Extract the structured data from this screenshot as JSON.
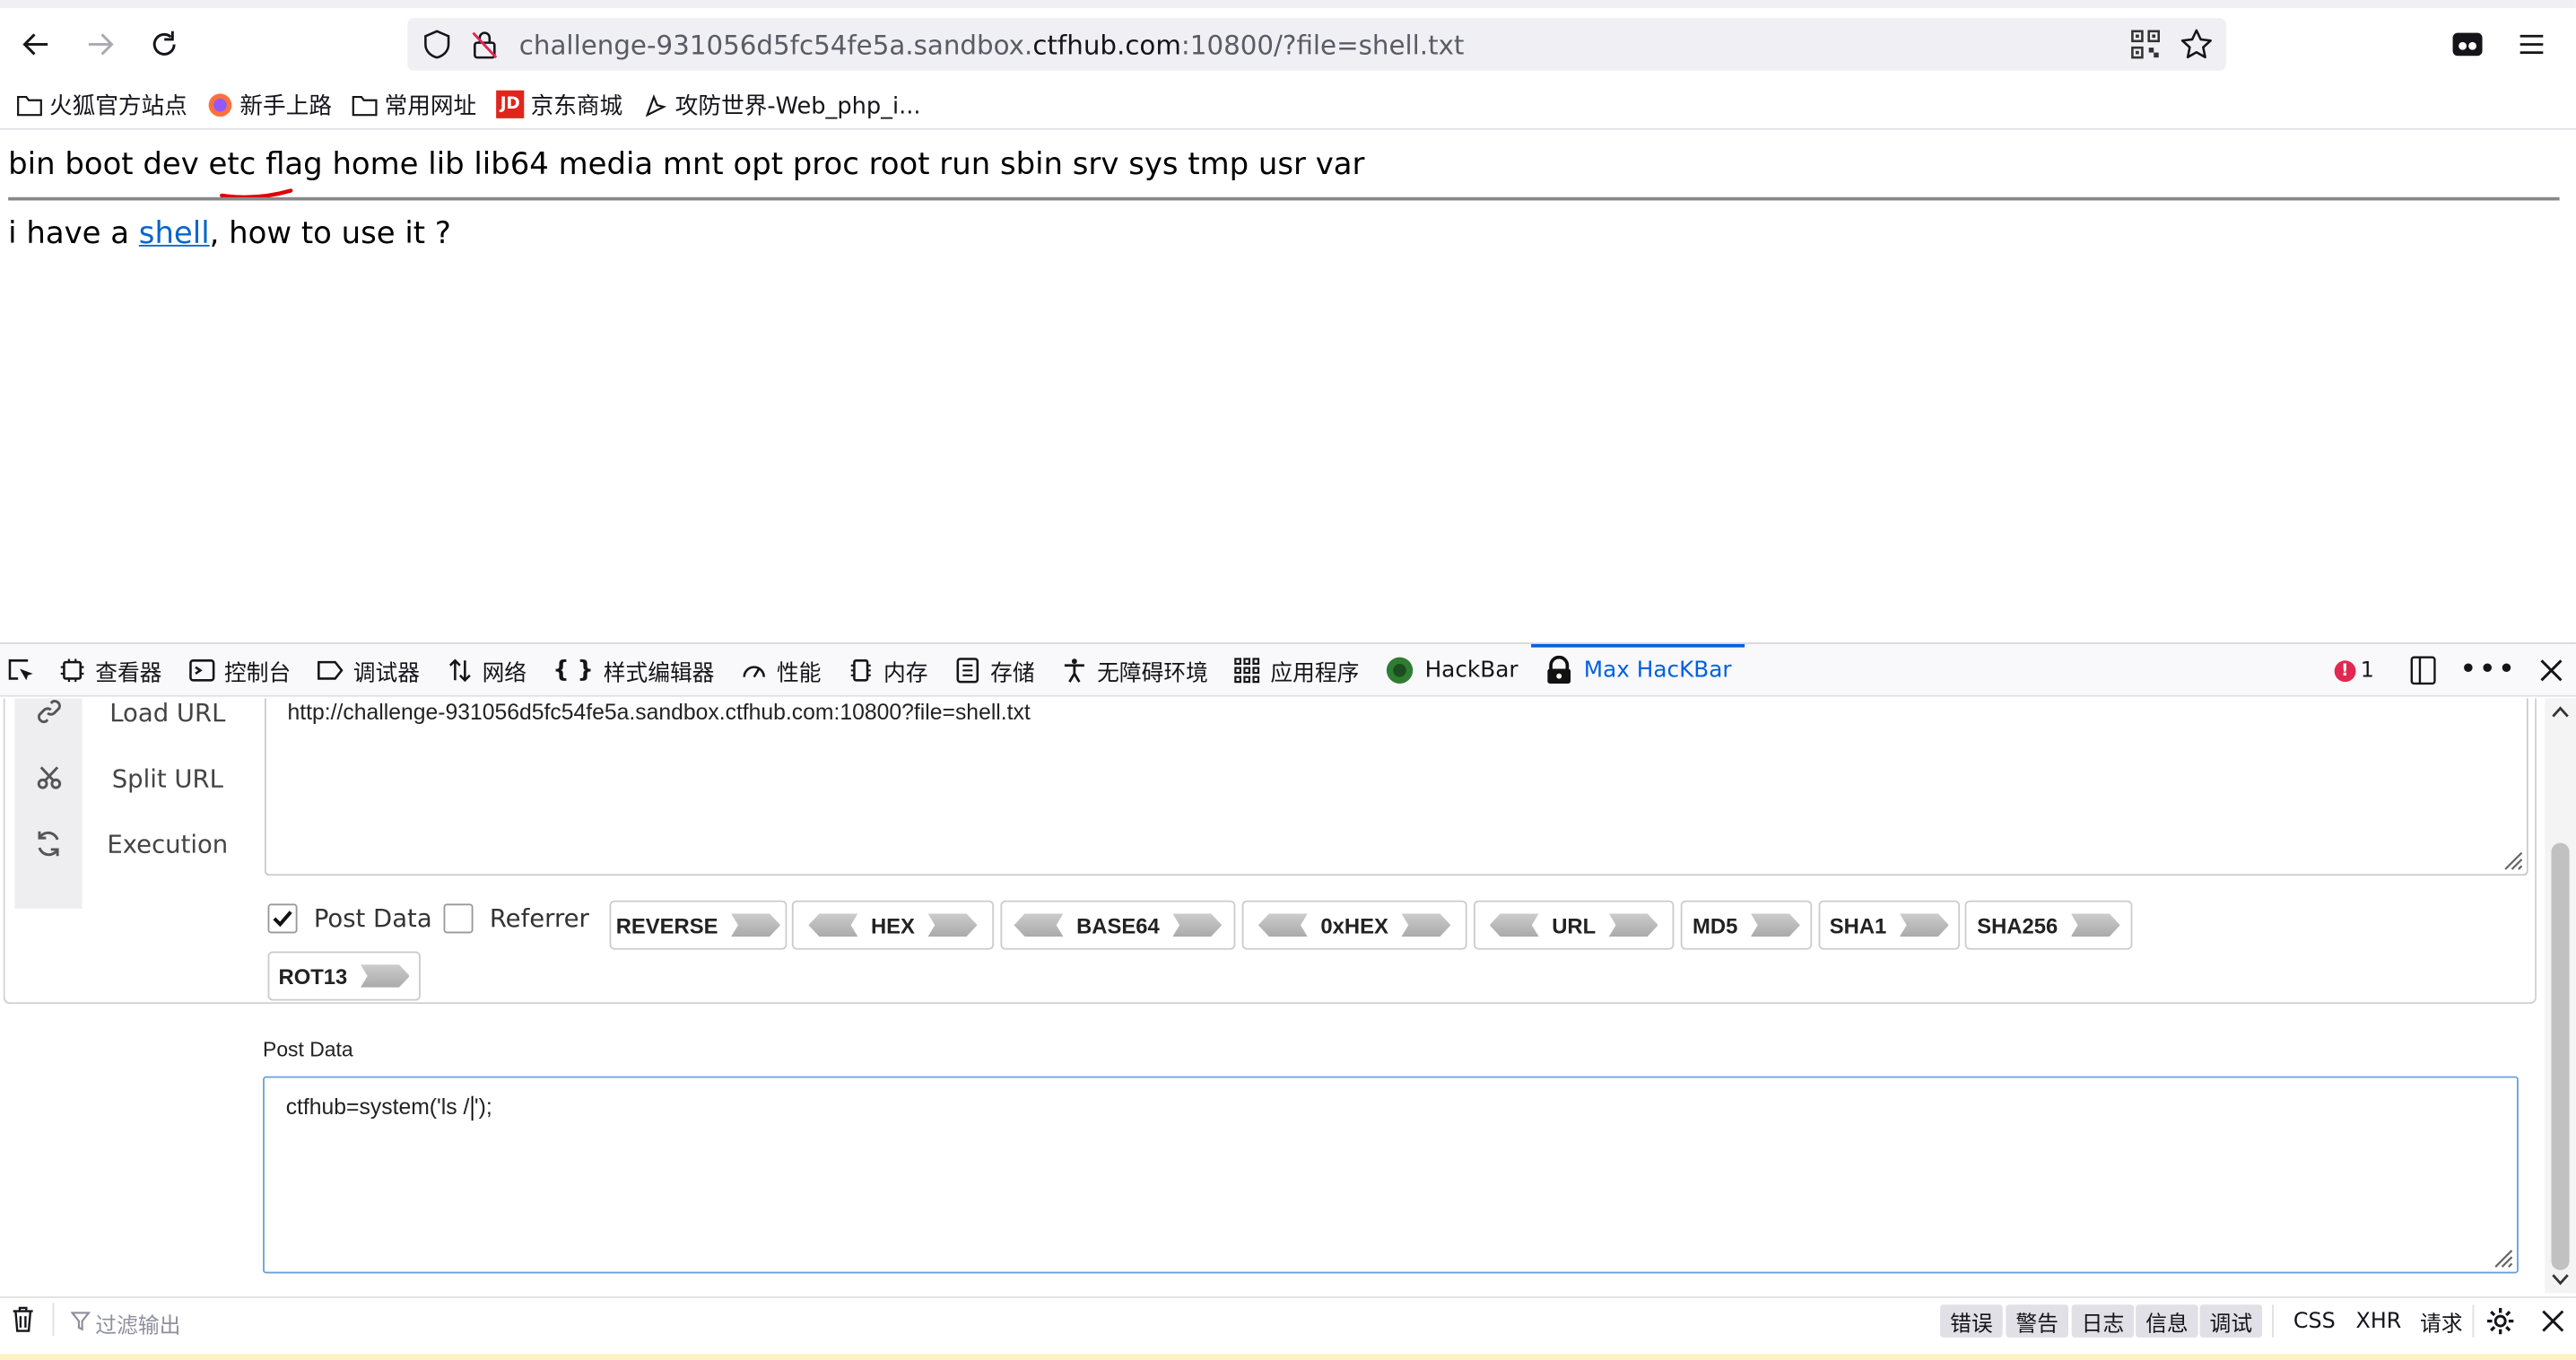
{
  "browser": {
    "url_prefix": "challenge-931056d5fc54fe5a.sandbox.",
    "url_host": "ctfhub.com",
    "url_suffix": ":10800/?file=shell.txt"
  },
  "bookmarks": [
    {
      "label": "火狐官方站点",
      "icon": "folder-icon"
    },
    {
      "label": "新手上路",
      "icon": "firefox-icon"
    },
    {
      "label": "常用网址",
      "icon": "folder-icon"
    },
    {
      "label": "京东商城",
      "icon": "jd-icon"
    },
    {
      "label": "攻防世界-Web_php_i...",
      "icon": "page-icon"
    }
  ],
  "page": {
    "ls_output": "bin boot dev etc flag home lib lib64 media mnt opt proc root run sbin srv sys tmp usr var",
    "line_before": "i have a ",
    "link_text": "shell",
    "line_after": ", how to use it ?"
  },
  "devtools": {
    "tabs": [
      {
        "label": "查看器",
        "icon": "inspector-icon"
      },
      {
        "label": "控制台",
        "icon": "console-icon"
      },
      {
        "label": "调试器",
        "icon": "debugger-icon"
      },
      {
        "label": "网络",
        "icon": "network-icon"
      },
      {
        "label": "样式编辑器",
        "icon": "style-editor-icon"
      },
      {
        "label": "性能",
        "icon": "performance-icon"
      },
      {
        "label": "内存",
        "icon": "memory-icon"
      },
      {
        "label": "存储",
        "icon": "storage-icon"
      },
      {
        "label": "无障碍环境",
        "icon": "accessibility-icon"
      },
      {
        "label": "应用程序",
        "icon": "application-icon"
      },
      {
        "label": "HackBar",
        "icon": "hackbar-icon"
      },
      {
        "label": "Max HacKBar",
        "icon": "max-hackbar-icon"
      }
    ],
    "error_count": "1"
  },
  "hackbar": {
    "load_url": "Load URL",
    "split_url": "Split URL",
    "execution": "Execution",
    "url_value": "http://challenge-931056d5fc54fe5a.sandbox.ctfhub.com:10800?file=shell.txt",
    "post_data_checkbox": "Post Data",
    "post_data_checked": true,
    "referrer_checkbox": "Referrer",
    "referrer_checked": false,
    "encoders": [
      "REVERSE",
      "HEX",
      "BASE64",
      "0xHEX",
      "URL",
      "MD5",
      "SHA1",
      "SHA256",
      "ROT13"
    ],
    "post_data_label": "Post Data",
    "post_data_before_caret": "ctfhub=system('ls /",
    "post_data_after_caret": "');"
  },
  "console": {
    "filter_placeholder": "过滤输出",
    "levels": [
      {
        "label": "错误",
        "active": true
      },
      {
        "label": "警告",
        "active": true
      },
      {
        "label": "日志",
        "active": true
      },
      {
        "label": "信息",
        "active": true
      },
      {
        "label": "调试",
        "active": true
      }
    ],
    "css": "CSS",
    "xhr": "XHR",
    "requests": "请求"
  },
  "colors": {
    "accent": "#0061e0",
    "link": "#0066cc",
    "error": "#e22850",
    "annotation": "#e00000"
  }
}
